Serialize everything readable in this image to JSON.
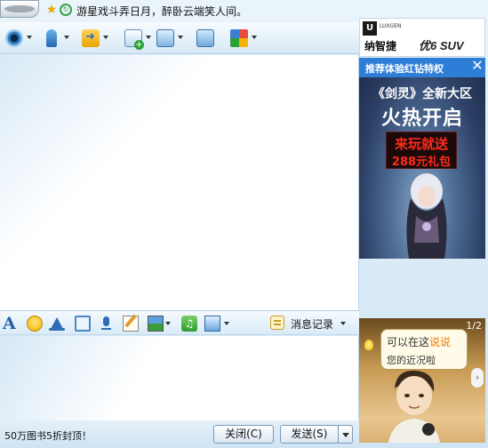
{
  "header": {
    "signature": "游星戏斗弄日月，醉卧云端笑人间。"
  },
  "toolbar": {
    "items": [
      {
        "icon": "webcam-icon"
      },
      {
        "icon": "microphone-icon"
      },
      {
        "icon": "send-file-icon"
      },
      {
        "icon": "create-discussion-icon"
      },
      {
        "icon": "remote-assist-icon"
      },
      {
        "icon": "share-screen-icon"
      },
      {
        "icon": "apps-icon"
      }
    ]
  },
  "side_ads": {
    "brand": {
      "logo_letter": "U",
      "tagline": "LUXGEN",
      "name": "纳智捷",
      "model": "优6 SUV"
    },
    "promo": {
      "bar_text": "推荐体验红钻特权",
      "close_glyph": "✕",
      "line1": "《剑灵》全新大区",
      "line2": "火热开启",
      "box_line1": "来玩就送",
      "box_line2": "288元礼包"
    },
    "card": {
      "page": "1/2",
      "bubble_prefix": "可以在这",
      "bubble_highlight": "说说",
      "bubble_line2": "您的近况啦",
      "next_glyph": "›"
    }
  },
  "input_toolbar": {
    "font_glyph": "A",
    "music_glyph": "♫",
    "history_label": "消息记录"
  },
  "footer": {
    "link_text": "50万图书5折封顶！",
    "close_button": "关闭(C)",
    "send_button": "发送(S)"
  },
  "colors": {
    "accent_blue": "#2e7ed8",
    "promo_red": "#ff2a1a",
    "highlight_orange": "#f07800"
  }
}
